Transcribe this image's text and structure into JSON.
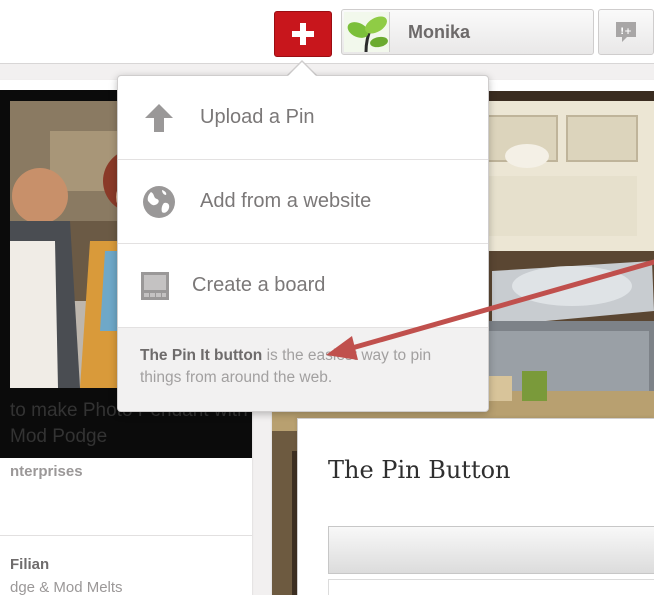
{
  "header": {
    "add_icon": "plus-icon",
    "user_name": "Monika",
    "notifications_icon": "notifications-icon"
  },
  "add_menu": {
    "items": [
      {
        "label": "Upload a Pin",
        "icon": "upload-arrow-icon"
      },
      {
        "label": "Add from a website",
        "icon": "globe-icon"
      },
      {
        "label": "Create a board",
        "icon": "board-icon"
      }
    ],
    "footer": {
      "bold": "The Pin It button",
      "text": " is the easiest way to pin things from around the web."
    }
  },
  "left_pin": {
    "title": "to make Photo Pendant with Mod Podge",
    "source": "nterprises",
    "pinner": "Filian",
    "board": "dge & Mod Melts"
  },
  "pin_dialog": {
    "title": "The Pin Button"
  },
  "colors": {
    "brand_red": "#c8161c",
    "annotation_arrow": "#c0504d"
  }
}
